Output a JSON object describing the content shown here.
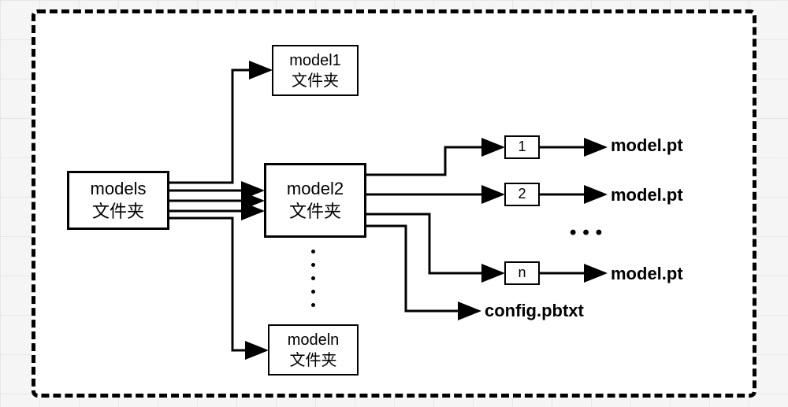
{
  "root": {
    "line1": "models",
    "line2": "文件夹"
  },
  "level2": {
    "model1": {
      "line1": "model1",
      "line2": "文件夹"
    },
    "model2": {
      "line1": "model2",
      "line2": "文件夹"
    },
    "modeln": {
      "line1": "modeln",
      "line2": "文件夹"
    }
  },
  "versions": {
    "v1": "1",
    "v2": "2",
    "vn": "n"
  },
  "files": {
    "model1": "model.pt",
    "model2": "model.pt",
    "modeln": "model.pt",
    "config": "config.pbtxt"
  },
  "ellipsis_h": "•••",
  "ellipsis_v": "vertical"
}
